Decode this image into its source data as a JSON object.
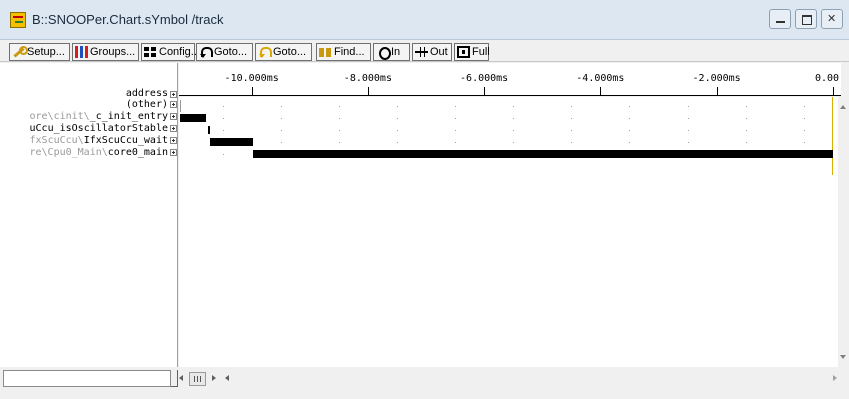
{
  "window": {
    "title": "B::SNOOPer.Chart.sYmbol /track"
  },
  "toolbar": {
    "buttons": [
      {
        "label": "Setup...",
        "icon": "wrench-icon"
      },
      {
        "label": "Groups...",
        "icon": "groups-icon"
      },
      {
        "label": "Config...",
        "icon": "config-icon"
      },
      {
        "label": "Goto...",
        "icon": "goto-icon"
      },
      {
        "label": "Goto...",
        "icon": "goto-yellow-icon"
      },
      {
        "label": "Find...",
        "icon": "binoculars-icon"
      },
      {
        "label": "In",
        "icon": "zoom-in-icon"
      },
      {
        "label": "Out",
        "icon": "zoom-out-icon"
      },
      {
        "label": "Full",
        "icon": "full-icon"
      }
    ]
  },
  "chart": {
    "header_label": "address",
    "rows": [
      {
        "grey": "",
        "name": "(other)"
      },
      {
        "grey": "ore\\cinit\\",
        "name": "_c_init_entry"
      },
      {
        "grey": "",
        "name": "uCcu_isOscillatorStable"
      },
      {
        "grey": "fxScuCcu\\",
        "name": "IfxScuCcu_wait"
      },
      {
        "grey": "re\\Cpu0_Main\\",
        "name": "core0_main"
      }
    ],
    "ticks": [
      "-10.000ms",
      "-8.000ms",
      "-6.000ms",
      "-4.000ms",
      "-2.000ms",
      "0.00"
    ],
    "time_ms": {
      "min": -11.25,
      "max": 0.14,
      "tick_values": [
        -10,
        -8,
        -6,
        -4,
        -2,
        0
      ]
    },
    "activity_ms": [
      {
        "row": 0,
        "start": -11.24,
        "end": -11.22
      },
      {
        "row": 1,
        "start": -11.24,
        "end": -10.78
      },
      {
        "row": 2,
        "start": -10.75,
        "end": -10.72
      },
      {
        "row": 3,
        "start": -10.72,
        "end": -9.97
      },
      {
        "row": 4,
        "start": -9.97,
        "end": 0.0
      }
    ],
    "cursor_color": "#d8b000"
  }
}
